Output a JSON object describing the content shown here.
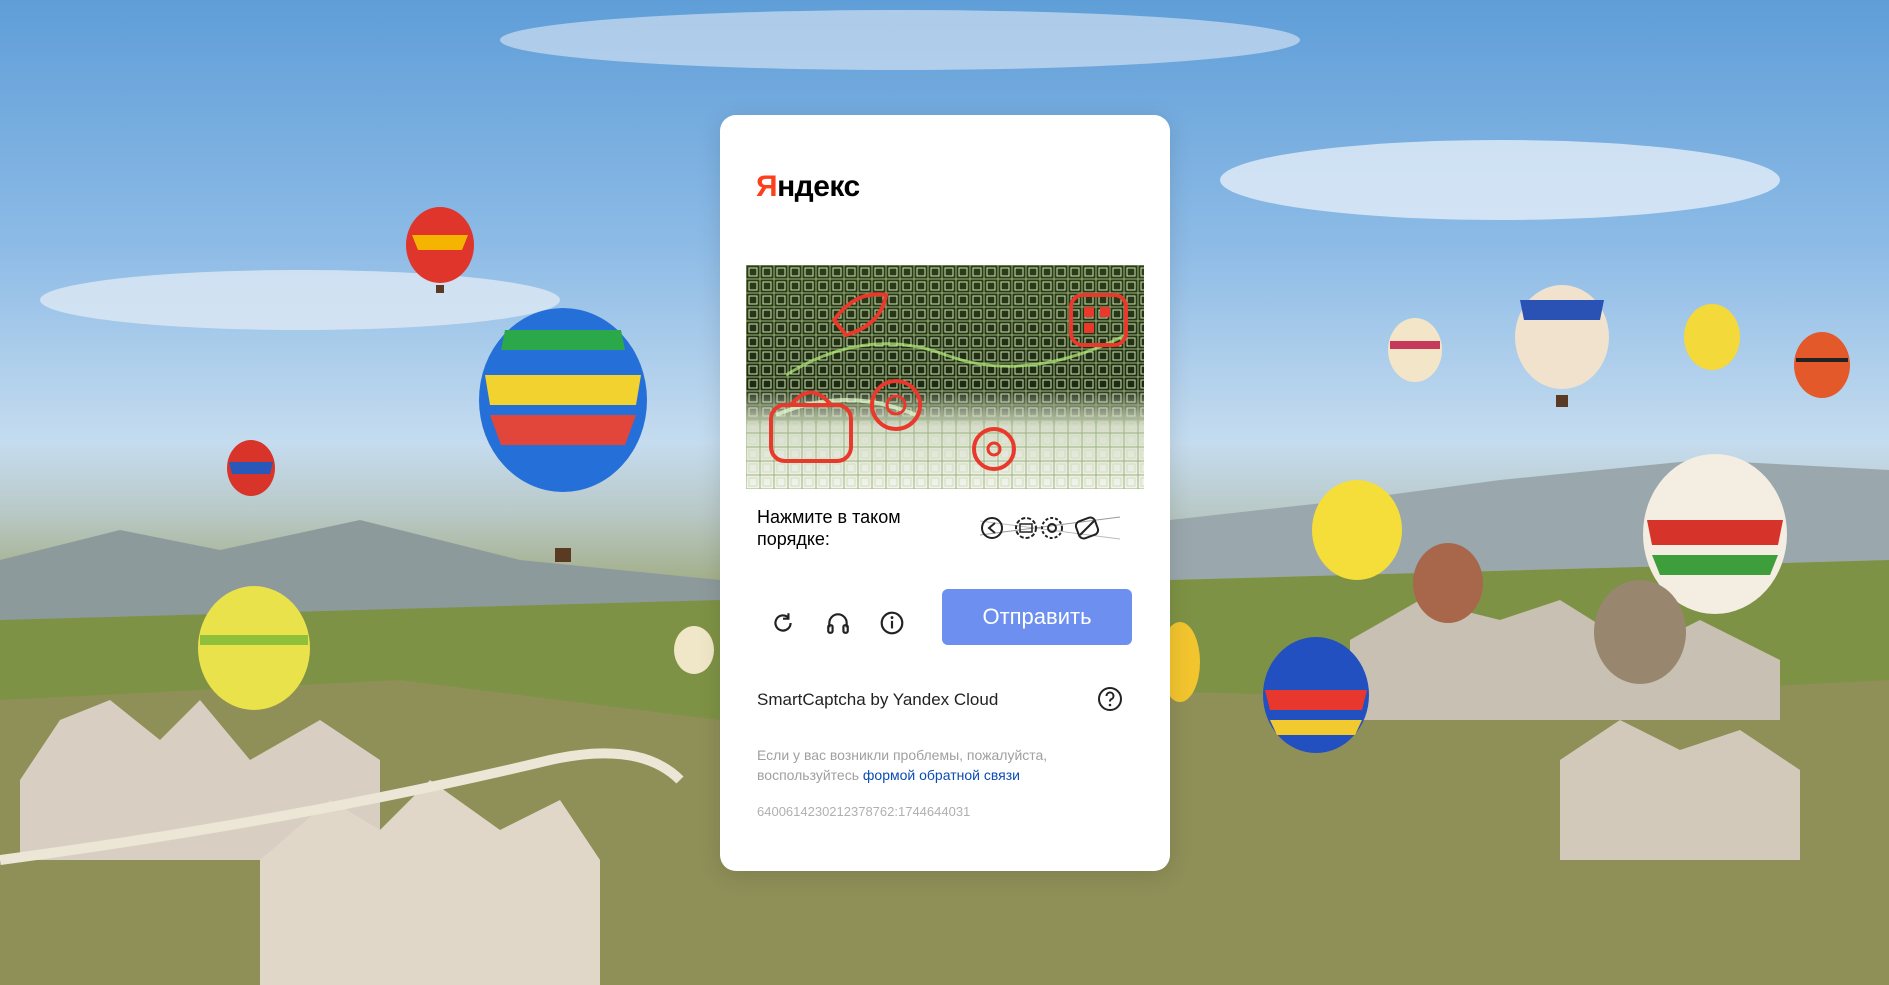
{
  "logo": {
    "first_letter": "Я",
    "rest": "ндекс"
  },
  "captcha": {
    "task_label": "Нажмите в таком порядке:",
    "task_icon_count": 4
  },
  "controls": {
    "refresh_icon": "refresh-icon",
    "audio_icon": "headphones-icon",
    "info_icon": "info-icon",
    "submit_label": "Отправить"
  },
  "footer": {
    "brand": "SmartCaptcha by Yandex Cloud",
    "help_icon": "question-icon",
    "help_text": "Если у вас возникли проблемы, пожалуйста, воспользуйтесь",
    "help_link": "формой обратной связи",
    "token": "6400614230212378762:1744644031"
  },
  "colors": {
    "brand_red": "#fc3f1d",
    "submit_bg": "#6c8ff0",
    "link": "#0b4bb3"
  }
}
